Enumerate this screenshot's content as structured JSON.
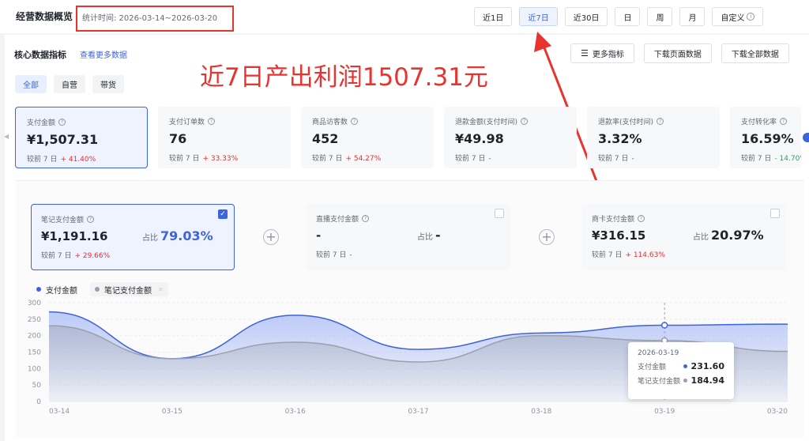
{
  "header": {
    "title": "经营数据概览",
    "range_label": "统计时间: 2026-03-14~2026-03-20",
    "periods": [
      "近1日",
      "近7日",
      "近30日",
      "日",
      "周",
      "月",
      "自定义"
    ],
    "active_period": "近7日"
  },
  "core": {
    "title": "核心数据指标",
    "more_link": "查看更多数据",
    "actions": [
      "更多指标",
      "下载页面数据",
      "下载全部数据"
    ],
    "filters": [
      "全部",
      "自营",
      "带货"
    ],
    "active_filter": "全部"
  },
  "annotation": "近7日产出利润1507.31元",
  "metrics": [
    {
      "label": "支付金额",
      "value": "¥1,507.31",
      "compare": "较前 7 日",
      "change": "+ 41.40%",
      "dir": "up"
    },
    {
      "label": "支付订单数",
      "value": "76",
      "compare": "较前 7 日",
      "change": "+ 33.33%",
      "dir": "up"
    },
    {
      "label": "商品访客数",
      "value": "452",
      "compare": "较前 7 日",
      "change": "+ 54.27%",
      "dir": "up"
    },
    {
      "label": "退款金额(支付时间)",
      "value": "¥49.98",
      "compare": "较前 7 日",
      "change": "-",
      "dir": "none"
    },
    {
      "label": "退款率(支付时间)",
      "value": "3.32%",
      "compare": "较前 7 日",
      "change": "-",
      "dir": "none"
    },
    {
      "label": "支付转化率",
      "value": "16.59%",
      "compare": "较前 7 日",
      "change": "- 14.70%",
      "dir": "down"
    }
  ],
  "breakdown": [
    {
      "label": "笔记支付金额",
      "value": "¥1,191.16",
      "share_label": "占比",
      "share": "79.03%",
      "compare": "较前 7 日",
      "change": "+ 29.66%",
      "active": true
    },
    {
      "label": "直播支付金额",
      "value": "-",
      "share_label": "占比",
      "share": "-",
      "compare": "较前 7 日",
      "change": "-",
      "active": false
    },
    {
      "label": "商卡支付金额",
      "value": "¥316.15",
      "share_label": "占比",
      "share": "20.97%",
      "compare": "较前 7 日",
      "change": "+ 114.63%",
      "active": false
    }
  ],
  "legend": [
    "支付金额",
    "笔记支付金额"
  ],
  "tooltip": {
    "date": "2026-03-19",
    "rows": [
      {
        "name": "支付金额",
        "value": "231.60"
      },
      {
        "name": "笔记支付金额",
        "value": "184.94"
      }
    ]
  },
  "colors": {
    "primary": "#3d63dd",
    "secondary": "#9aa0ab",
    "alert": "#e8332f"
  },
  "chart_data": {
    "type": "area",
    "x": [
      "03-14",
      "03-15",
      "03-16",
      "03-17",
      "03-18",
      "03-19",
      "03-20"
    ],
    "series": [
      {
        "name": "支付金额",
        "values": [
          272,
          130,
          262,
          158,
          208,
          231.6,
          235
        ]
      },
      {
        "name": "笔记支付金额",
        "values": [
          230,
          130,
          180,
          120,
          200,
          184.94,
          152
        ]
      }
    ],
    "ylim": [
      0,
      300
    ],
    "yticks": [
      0,
      50,
      100,
      150,
      200,
      250,
      300
    ],
    "highlight_index": 5
  }
}
